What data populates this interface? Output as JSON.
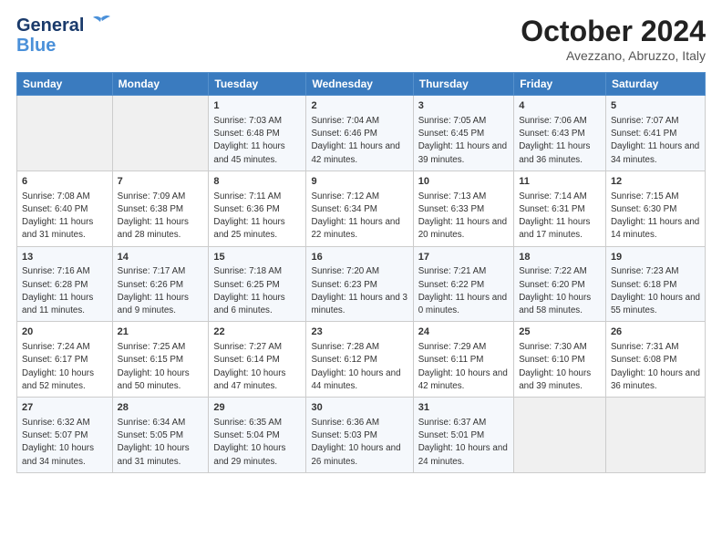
{
  "header": {
    "logo_line1": "General",
    "logo_line2": "Blue",
    "month": "October 2024",
    "location": "Avezzano, Abruzzo, Italy"
  },
  "weekdays": [
    "Sunday",
    "Monday",
    "Tuesday",
    "Wednesday",
    "Thursday",
    "Friday",
    "Saturday"
  ],
  "weeks": [
    [
      {
        "day": "",
        "info": ""
      },
      {
        "day": "",
        "info": ""
      },
      {
        "day": "1",
        "info": "Sunrise: 7:03 AM\nSunset: 6:48 PM\nDaylight: 11 hours and 45 minutes."
      },
      {
        "day": "2",
        "info": "Sunrise: 7:04 AM\nSunset: 6:46 PM\nDaylight: 11 hours and 42 minutes."
      },
      {
        "day": "3",
        "info": "Sunrise: 7:05 AM\nSunset: 6:45 PM\nDaylight: 11 hours and 39 minutes."
      },
      {
        "day": "4",
        "info": "Sunrise: 7:06 AM\nSunset: 6:43 PM\nDaylight: 11 hours and 36 minutes."
      },
      {
        "day": "5",
        "info": "Sunrise: 7:07 AM\nSunset: 6:41 PM\nDaylight: 11 hours and 34 minutes."
      }
    ],
    [
      {
        "day": "6",
        "info": "Sunrise: 7:08 AM\nSunset: 6:40 PM\nDaylight: 11 hours and 31 minutes."
      },
      {
        "day": "7",
        "info": "Sunrise: 7:09 AM\nSunset: 6:38 PM\nDaylight: 11 hours and 28 minutes."
      },
      {
        "day": "8",
        "info": "Sunrise: 7:11 AM\nSunset: 6:36 PM\nDaylight: 11 hours and 25 minutes."
      },
      {
        "day": "9",
        "info": "Sunrise: 7:12 AM\nSunset: 6:34 PM\nDaylight: 11 hours and 22 minutes."
      },
      {
        "day": "10",
        "info": "Sunrise: 7:13 AM\nSunset: 6:33 PM\nDaylight: 11 hours and 20 minutes."
      },
      {
        "day": "11",
        "info": "Sunrise: 7:14 AM\nSunset: 6:31 PM\nDaylight: 11 hours and 17 minutes."
      },
      {
        "day": "12",
        "info": "Sunrise: 7:15 AM\nSunset: 6:30 PM\nDaylight: 11 hours and 14 minutes."
      }
    ],
    [
      {
        "day": "13",
        "info": "Sunrise: 7:16 AM\nSunset: 6:28 PM\nDaylight: 11 hours and 11 minutes."
      },
      {
        "day": "14",
        "info": "Sunrise: 7:17 AM\nSunset: 6:26 PM\nDaylight: 11 hours and 9 minutes."
      },
      {
        "day": "15",
        "info": "Sunrise: 7:18 AM\nSunset: 6:25 PM\nDaylight: 11 hours and 6 minutes."
      },
      {
        "day": "16",
        "info": "Sunrise: 7:20 AM\nSunset: 6:23 PM\nDaylight: 11 hours and 3 minutes."
      },
      {
        "day": "17",
        "info": "Sunrise: 7:21 AM\nSunset: 6:22 PM\nDaylight: 11 hours and 0 minutes."
      },
      {
        "day": "18",
        "info": "Sunrise: 7:22 AM\nSunset: 6:20 PM\nDaylight: 10 hours and 58 minutes."
      },
      {
        "day": "19",
        "info": "Sunrise: 7:23 AM\nSunset: 6:18 PM\nDaylight: 10 hours and 55 minutes."
      }
    ],
    [
      {
        "day": "20",
        "info": "Sunrise: 7:24 AM\nSunset: 6:17 PM\nDaylight: 10 hours and 52 minutes."
      },
      {
        "day": "21",
        "info": "Sunrise: 7:25 AM\nSunset: 6:15 PM\nDaylight: 10 hours and 50 minutes."
      },
      {
        "day": "22",
        "info": "Sunrise: 7:27 AM\nSunset: 6:14 PM\nDaylight: 10 hours and 47 minutes."
      },
      {
        "day": "23",
        "info": "Sunrise: 7:28 AM\nSunset: 6:12 PM\nDaylight: 10 hours and 44 minutes."
      },
      {
        "day": "24",
        "info": "Sunrise: 7:29 AM\nSunset: 6:11 PM\nDaylight: 10 hours and 42 minutes."
      },
      {
        "day": "25",
        "info": "Sunrise: 7:30 AM\nSunset: 6:10 PM\nDaylight: 10 hours and 39 minutes."
      },
      {
        "day": "26",
        "info": "Sunrise: 7:31 AM\nSunset: 6:08 PM\nDaylight: 10 hours and 36 minutes."
      }
    ],
    [
      {
        "day": "27",
        "info": "Sunrise: 6:32 AM\nSunset: 5:07 PM\nDaylight: 10 hours and 34 minutes."
      },
      {
        "day": "28",
        "info": "Sunrise: 6:34 AM\nSunset: 5:05 PM\nDaylight: 10 hours and 31 minutes."
      },
      {
        "day": "29",
        "info": "Sunrise: 6:35 AM\nSunset: 5:04 PM\nDaylight: 10 hours and 29 minutes."
      },
      {
        "day": "30",
        "info": "Sunrise: 6:36 AM\nSunset: 5:03 PM\nDaylight: 10 hours and 26 minutes."
      },
      {
        "day": "31",
        "info": "Sunrise: 6:37 AM\nSunset: 5:01 PM\nDaylight: 10 hours and 24 minutes."
      },
      {
        "day": "",
        "info": ""
      },
      {
        "day": "",
        "info": ""
      }
    ]
  ]
}
